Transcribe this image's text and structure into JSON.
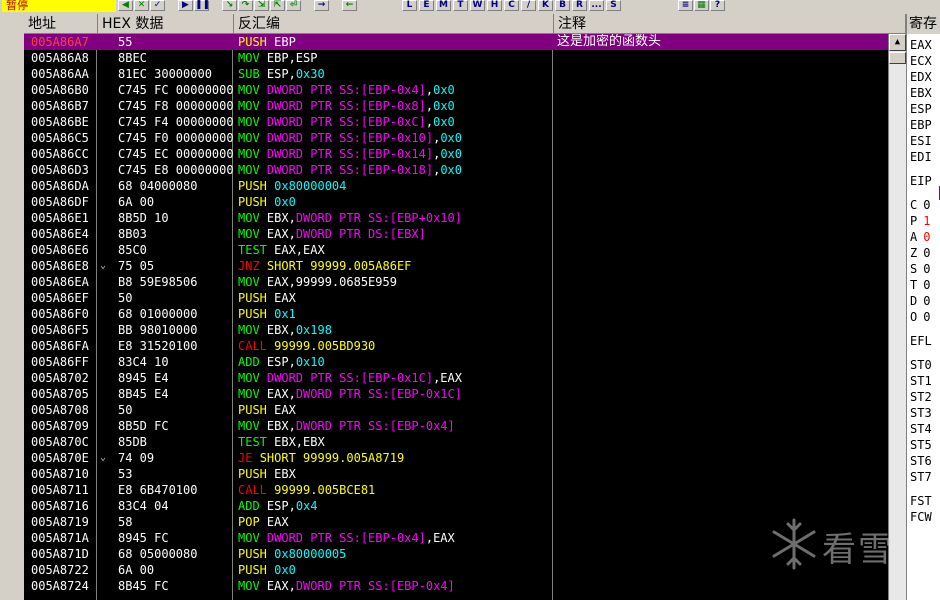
{
  "toolbar": {
    "status_text": "暂停",
    "buttons": [
      "L",
      "E",
      "M",
      "T",
      "W",
      "H",
      "C",
      "/",
      "K",
      "B",
      "R",
      "...",
      "S"
    ]
  },
  "columns": {
    "address": "地址",
    "hex": "HEX 数据",
    "disasm": "反汇编",
    "comment": "注释",
    "registers": "寄存"
  },
  "rows": [
    {
      "addr": "005A86A7",
      "hex": "55",
      "dis": [
        [
          "PUSH ",
          "k-push"
        ],
        [
          "EBP",
          "op"
        ]
      ],
      "comment": "这是加密的函数头",
      "selected": true
    },
    {
      "addr": "005A86A8",
      "hex": "8BEC",
      "dis": [
        [
          "MOV ",
          "k-mov"
        ],
        [
          "EBP,ESP",
          "op"
        ]
      ]
    },
    {
      "addr": "005A86AA",
      "hex": "81EC 30000000",
      "dis": [
        [
          "SUB ",
          "k-sub"
        ],
        [
          "ESP,",
          "op"
        ],
        [
          "0x30",
          "imm"
        ]
      ]
    },
    {
      "addr": "005A86B0",
      "hex": "C745 FC 00000000",
      "dis": [
        [
          "MOV ",
          "k-mov"
        ],
        [
          "DWORD PTR SS:[EBP-0x4]",
          "ptr"
        ],
        [
          ",",
          "op"
        ],
        [
          "0x0",
          "imm"
        ]
      ]
    },
    {
      "addr": "005A86B7",
      "hex": "C745 F8 00000000",
      "dis": [
        [
          "MOV ",
          "k-mov"
        ],
        [
          "DWORD PTR SS:[EBP-0x8]",
          "ptr"
        ],
        [
          ",",
          "op"
        ],
        [
          "0x0",
          "imm"
        ]
      ]
    },
    {
      "addr": "005A86BE",
      "hex": "C745 F4 00000000",
      "dis": [
        [
          "MOV ",
          "k-mov"
        ],
        [
          "DWORD PTR SS:[EBP-0xC]",
          "ptr"
        ],
        [
          ",",
          "op"
        ],
        [
          "0x0",
          "imm"
        ]
      ]
    },
    {
      "addr": "005A86C5",
      "hex": "C745 F0 00000000",
      "dis": [
        [
          "MOV ",
          "k-mov"
        ],
        [
          "DWORD PTR SS:[EBP-0x10]",
          "ptr"
        ],
        [
          ",",
          "op"
        ],
        [
          "0x0",
          "imm"
        ]
      ]
    },
    {
      "addr": "005A86CC",
      "hex": "C745 EC 00000000",
      "dis": [
        [
          "MOV ",
          "k-mov"
        ],
        [
          "DWORD PTR SS:[EBP-0x14]",
          "ptr"
        ],
        [
          ",",
          "op"
        ],
        [
          "0x0",
          "imm"
        ]
      ]
    },
    {
      "addr": "005A86D3",
      "hex": "C745 E8 00000000",
      "dis": [
        [
          "MOV ",
          "k-mov"
        ],
        [
          "DWORD PTR SS:[EBP-0x18]",
          "ptr"
        ],
        [
          ",",
          "op"
        ],
        [
          "0x0",
          "imm"
        ]
      ]
    },
    {
      "addr": "005A86DA",
      "hex": "68 04000080",
      "dis": [
        [
          "PUSH ",
          "k-push"
        ],
        [
          "0x80000004",
          "imm"
        ]
      ]
    },
    {
      "addr": "005A86DF",
      "hex": "6A 00",
      "dis": [
        [
          "PUSH ",
          "k-push"
        ],
        [
          "0x0",
          "imm"
        ]
      ]
    },
    {
      "addr": "005A86E1",
      "hex": "8B5D 10",
      "dis": [
        [
          "MOV ",
          "k-mov"
        ],
        [
          "EBX,",
          "op"
        ],
        [
          "DWORD PTR SS:[EBP+0x10]",
          "ptr"
        ]
      ]
    },
    {
      "addr": "005A86E4",
      "hex": "8B03",
      "dis": [
        [
          "MOV ",
          "k-mov"
        ],
        [
          "EAX,",
          "op"
        ],
        [
          "DWORD PTR DS:[EBX]",
          "ptr"
        ]
      ]
    },
    {
      "addr": "005A86E6",
      "hex": "85C0",
      "dis": [
        [
          "TEST ",
          "k-test"
        ],
        [
          "EAX,EAX",
          "op"
        ]
      ]
    },
    {
      "addr": "005A86E8",
      "hex": "75 05",
      "jump": true,
      "dis": [
        [
          "JNZ ",
          "k-jnz"
        ],
        [
          "SHORT 99999.005A86EF",
          "tgt"
        ]
      ]
    },
    {
      "addr": "005A86EA",
      "hex": "B8 59E98506",
      "dis": [
        [
          "MOV ",
          "k-mov"
        ],
        [
          "EAX,99999.0685E959",
          "op"
        ]
      ]
    },
    {
      "addr": "005A86EF",
      "hex": "50",
      "dis": [
        [
          "PUSH ",
          "k-push"
        ],
        [
          "EAX",
          "op"
        ]
      ]
    },
    {
      "addr": "005A86F0",
      "hex": "68 01000000",
      "dis": [
        [
          "PUSH ",
          "k-push"
        ],
        [
          "0x1",
          "imm"
        ]
      ]
    },
    {
      "addr": "005A86F5",
      "hex": "BB 98010000",
      "dis": [
        [
          "MOV ",
          "k-mov"
        ],
        [
          "EBX,",
          "op"
        ],
        [
          "0x198",
          "imm"
        ]
      ]
    },
    {
      "addr": "005A86FA",
      "hex": "E8 31520100",
      "dis": [
        [
          "CALL ",
          "k-call"
        ],
        [
          "99999.005BD930",
          "tgt"
        ]
      ]
    },
    {
      "addr": "005A86FF",
      "hex": "83C4 10",
      "dis": [
        [
          "ADD ",
          "k-add"
        ],
        [
          "ESP,",
          "op"
        ],
        [
          "0x10",
          "imm"
        ]
      ]
    },
    {
      "addr": "005A8702",
      "hex": "8945 E4",
      "dis": [
        [
          "MOV ",
          "k-mov"
        ],
        [
          "DWORD PTR SS:[EBP-0x1C]",
          "ptr"
        ],
        [
          ",EAX",
          "op"
        ]
      ]
    },
    {
      "addr": "005A8705",
      "hex": "8B45 E4",
      "dis": [
        [
          "MOV ",
          "k-mov"
        ],
        [
          "EAX,",
          "op"
        ],
        [
          "DWORD PTR SS:[EBP-0x1C]",
          "ptr"
        ]
      ]
    },
    {
      "addr": "005A8708",
      "hex": "50",
      "dis": [
        [
          "PUSH ",
          "k-push"
        ],
        [
          "EAX",
          "op"
        ]
      ]
    },
    {
      "addr": "005A8709",
      "hex": "8B5D FC",
      "dis": [
        [
          "MOV ",
          "k-mov"
        ],
        [
          "EBX,",
          "op"
        ],
        [
          "DWORD PTR SS:[EBP-0x4]",
          "ptr"
        ]
      ]
    },
    {
      "addr": "005A870C",
      "hex": "85DB",
      "dis": [
        [
          "TEST ",
          "k-test"
        ],
        [
          "EBX,EBX",
          "op"
        ]
      ]
    },
    {
      "addr": "005A870E",
      "hex": "74 09",
      "jump": true,
      "dis": [
        [
          "JE ",
          "k-je"
        ],
        [
          "SHORT 99999.005A8719",
          "tgt"
        ]
      ]
    },
    {
      "addr": "005A8710",
      "hex": "53",
      "dis": [
        [
          "PUSH ",
          "k-push"
        ],
        [
          "EBX",
          "op"
        ]
      ]
    },
    {
      "addr": "005A8711",
      "hex": "E8 6B470100",
      "dis": [
        [
          "CALL ",
          "k-call"
        ],
        [
          "99999.005BCE81",
          "tgt"
        ]
      ]
    },
    {
      "addr": "005A8716",
      "hex": "83C4 04",
      "dis": [
        [
          "ADD ",
          "k-add"
        ],
        [
          "ESP,",
          "op"
        ],
        [
          "0x4",
          "imm"
        ]
      ]
    },
    {
      "addr": "005A8719",
      "hex": "58",
      "dis": [
        [
          "POP ",
          "k-pop"
        ],
        [
          "EAX",
          "op"
        ]
      ]
    },
    {
      "addr": "005A871A",
      "hex": "8945 FC",
      "dis": [
        [
          "MOV ",
          "k-mov"
        ],
        [
          "DWORD PTR SS:[EBP-0x4]",
          "ptr"
        ],
        [
          ",EAX",
          "op"
        ]
      ]
    },
    {
      "addr": "005A871D",
      "hex": "68 05000080",
      "dis": [
        [
          "PUSH ",
          "k-push"
        ],
        [
          "0x80000005",
          "imm"
        ]
      ]
    },
    {
      "addr": "005A8722",
      "hex": "6A 00",
      "dis": [
        [
          "PUSH ",
          "k-push"
        ],
        [
          "0x0",
          "imm"
        ]
      ]
    },
    {
      "addr": "005A8724",
      "hex": "8B45 FC",
      "dis": [
        [
          "MOV ",
          "k-mov"
        ],
        [
          "EAX,",
          "op"
        ],
        [
          "DWORD PTR SS:[EBP-0x4]",
          "ptr"
        ]
      ]
    }
  ],
  "registers": [
    {
      "name": "EAX",
      "val": ""
    },
    {
      "name": "ECX",
      "val": ""
    },
    {
      "name": "EDX",
      "val": ""
    },
    {
      "name": "EBX",
      "val": ""
    },
    {
      "name": "ESP",
      "val": ""
    },
    {
      "name": "EBP",
      "val": ""
    },
    {
      "name": "ESI",
      "val": ""
    },
    {
      "name": "EDI",
      "val": ""
    },
    {
      "name": "EIP",
      "val": "",
      "gap": true
    },
    {
      "name": "C",
      "val": "0",
      "gap": true
    },
    {
      "name": "P",
      "val": "1",
      "red": true
    },
    {
      "name": "A",
      "val": "0",
      "red": true
    },
    {
      "name": "Z",
      "val": "0"
    },
    {
      "name": "S",
      "val": "0"
    },
    {
      "name": "T",
      "val": "0"
    },
    {
      "name": "D",
      "val": "0"
    },
    {
      "name": "O",
      "val": "0"
    },
    {
      "name": "EFL",
      "val": "",
      "gap": true
    },
    {
      "name": "ST0",
      "val": "",
      "gap": true
    },
    {
      "name": "ST1",
      "val": ""
    },
    {
      "name": "ST2",
      "val": ""
    },
    {
      "name": "ST3",
      "val": ""
    },
    {
      "name": "ST4",
      "val": ""
    },
    {
      "name": "ST5",
      "val": ""
    },
    {
      "name": "ST6",
      "val": ""
    },
    {
      "name": "ST7",
      "val": ""
    },
    {
      "name": "FST",
      "val": "",
      "gap": true
    },
    {
      "name": "FCW",
      "val": ""
    }
  ],
  "watermark": {
    "text": "看雪"
  },
  "colors": {
    "selected_row": "#800080",
    "background": "#000000",
    "status_bg": "#ffff00"
  }
}
